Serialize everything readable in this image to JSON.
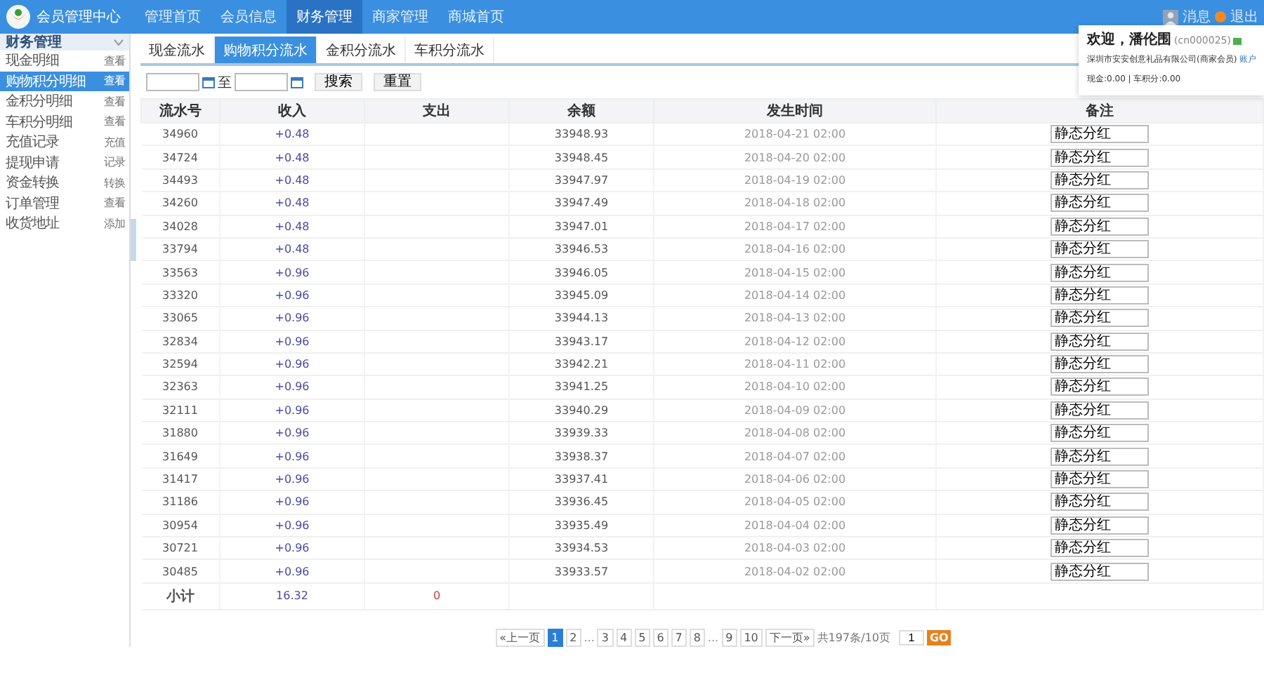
{
  "header": {
    "title": "会员管理中心",
    "nav": [
      {
        "label": "管理首页",
        "selected": false
      },
      {
        "label": "会员信息",
        "selected": false
      },
      {
        "label": "财务管理",
        "selected": true
      },
      {
        "label": "商家管理",
        "selected": false
      },
      {
        "label": "商城首页",
        "selected": false
      }
    ],
    "messages": "消息",
    "logout": "退出"
  },
  "user_card": {
    "greeting": "欢迎，潘伦围",
    "user_id": "(cn000025)",
    "company": "深圳市安安创意礼品有限公司(商家会员)",
    "account_link": "账户",
    "balances": "现金:0.00 | 车积分:0.00"
  },
  "sidebar": {
    "title": "财务管理",
    "items": [
      {
        "label": "现金明细",
        "action": "查看",
        "selected": false
      },
      {
        "label": "购物积分明细",
        "action": "查看",
        "selected": true
      },
      {
        "label": "金积分明细",
        "action": "查看",
        "selected": false
      },
      {
        "label": "车积分明细",
        "action": "查看",
        "selected": false
      },
      {
        "label": "充值记录",
        "action": "充值",
        "selected": false
      },
      {
        "label": "提现申请",
        "action": "记录",
        "selected": false
      },
      {
        "label": "资金转换",
        "action": "转换",
        "selected": false
      },
      {
        "label": "订单管理",
        "action": "查看",
        "selected": false
      },
      {
        "label": "收货地址",
        "action": "添加",
        "selected": false
      }
    ]
  },
  "tabs": [
    {
      "label": "现金流水",
      "selected": false
    },
    {
      "label": "购物积分流水",
      "selected": true
    },
    {
      "label": "金积分流水",
      "selected": false
    },
    {
      "label": "车积分流水",
      "selected": false
    }
  ],
  "search": {
    "range_separator": "至",
    "search_button": "搜索",
    "reset_button": "重置"
  },
  "table": {
    "columns": [
      "流水号",
      "收入",
      "支出",
      "余额",
      "发生时间",
      "备注"
    ],
    "rows": [
      {
        "id": "34960",
        "income": "+0.48",
        "balance": "33948.93",
        "time": "2018-04-21 02:00",
        "note": "静态分红"
      },
      {
        "id": "34724",
        "income": "+0.48",
        "balance": "33948.45",
        "time": "2018-04-20 02:00",
        "note": "静态分红"
      },
      {
        "id": "34493",
        "income": "+0.48",
        "balance": "33947.97",
        "time": "2018-04-19 02:00",
        "note": "静态分红"
      },
      {
        "id": "34260",
        "income": "+0.48",
        "balance": "33947.49",
        "time": "2018-04-18 02:00",
        "note": "静态分红"
      },
      {
        "id": "34028",
        "income": "+0.48",
        "balance": "33947.01",
        "time": "2018-04-17 02:00",
        "note": "静态分红"
      },
      {
        "id": "33794",
        "income": "+0.48",
        "balance": "33946.53",
        "time": "2018-04-16 02:00",
        "note": "静态分红"
      },
      {
        "id": "33563",
        "income": "+0.96",
        "balance": "33946.05",
        "time": "2018-04-15 02:00",
        "note": "静态分红"
      },
      {
        "id": "33320",
        "income": "+0.96",
        "balance": "33945.09",
        "time": "2018-04-14 02:00",
        "note": "静态分红"
      },
      {
        "id": "33065",
        "income": "+0.96",
        "balance": "33944.13",
        "time": "2018-04-13 02:00",
        "note": "静态分红"
      },
      {
        "id": "32834",
        "income": "+0.96",
        "balance": "33943.17",
        "time": "2018-04-12 02:00",
        "note": "静态分红"
      },
      {
        "id": "32594",
        "income": "+0.96",
        "balance": "33942.21",
        "time": "2018-04-11 02:00",
        "note": "静态分红"
      },
      {
        "id": "32363",
        "income": "+0.96",
        "balance": "33941.25",
        "time": "2018-04-10 02:00",
        "note": "静态分红"
      },
      {
        "id": "32111",
        "income": "+0.96",
        "balance": "33940.29",
        "time": "2018-04-09 02:00",
        "note": "静态分红"
      },
      {
        "id": "31880",
        "income": "+0.96",
        "balance": "33939.33",
        "time": "2018-04-08 02:00",
        "note": "静态分红"
      },
      {
        "id": "31649",
        "income": "+0.96",
        "balance": "33938.37",
        "time": "2018-04-07 02:00",
        "note": "静态分红"
      },
      {
        "id": "31417",
        "income": "+0.96",
        "balance": "33937.41",
        "time": "2018-04-06 02:00",
        "note": "静态分红"
      },
      {
        "id": "31186",
        "income": "+0.96",
        "balance": "33936.45",
        "time": "2018-04-05 02:00",
        "note": "静态分红"
      },
      {
        "id": "30954",
        "income": "+0.96",
        "balance": "33935.49",
        "time": "2018-04-04 02:00",
        "note": "静态分红"
      },
      {
        "id": "30721",
        "income": "+0.96",
        "balance": "33934.53",
        "time": "2018-04-03 02:00",
        "note": "静态分红"
      },
      {
        "id": "30485",
        "income": "+0.96",
        "balance": "33933.57",
        "time": "2018-04-02 02:00",
        "note": "静态分红"
      }
    ],
    "subtotal": {
      "label": "小计",
      "income": "16.32",
      "expense": "0"
    }
  },
  "pagination": {
    "items": [
      {
        "label": "«上一页",
        "kind": "link",
        "selected": false
      },
      {
        "label": "1",
        "kind": "link",
        "selected": true
      },
      {
        "label": "2",
        "kind": "link",
        "selected": false
      },
      {
        "label": "...",
        "kind": "gap"
      },
      {
        "label": "3",
        "kind": "link",
        "selected": false
      },
      {
        "label": "4",
        "kind": "link",
        "selected": false
      },
      {
        "label": "5",
        "kind": "link",
        "selected": false
      },
      {
        "label": "6",
        "kind": "link",
        "selected": false
      },
      {
        "label": "7",
        "kind": "link",
        "selected": false
      },
      {
        "label": "8",
        "kind": "link",
        "selected": false
      },
      {
        "label": "...",
        "kind": "gap"
      },
      {
        "label": "9",
        "kind": "link",
        "selected": false
      },
      {
        "label": "10",
        "kind": "link",
        "selected": false
      },
      {
        "label": "下一页»",
        "kind": "link",
        "selected": false
      }
    ],
    "summary": "共197条/10页",
    "page_input": "1",
    "go_button": "GO"
  }
}
